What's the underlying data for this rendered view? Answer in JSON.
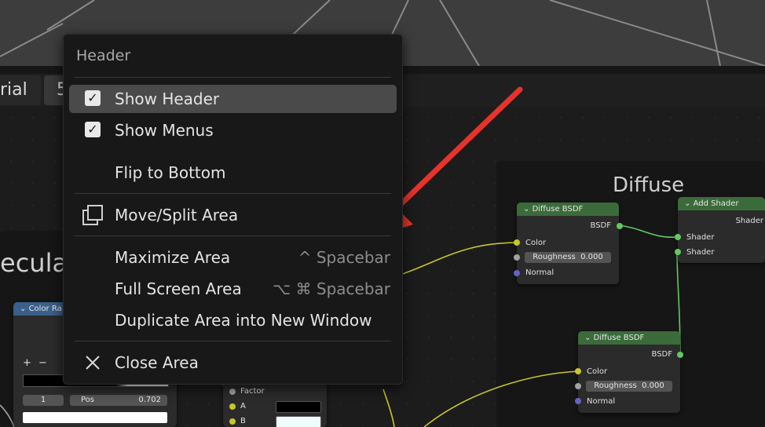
{
  "editor_header": {
    "material_text": "rial",
    "users_text": "5"
  },
  "frames": [
    {
      "label": "Diffuse"
    },
    {
      "label": "ecula"
    }
  ],
  "nodes": {
    "diffuse_bsdf_1": {
      "title": "Diffuse BSDF",
      "output": "BSDF",
      "color": "Color",
      "roughness_label": "Roughness",
      "roughness_value": "0.000",
      "normal": "Normal"
    },
    "diffuse_bsdf_2": {
      "title": "Diffuse BSDF",
      "output": "BSDF",
      "color": "Color",
      "roughness_label": "Roughness",
      "roughness_value": "0.000",
      "normal": "Normal"
    },
    "add_shader": {
      "title": "Add Shader",
      "output": "Shader",
      "in1": "Shader",
      "in2": "Shader"
    },
    "color_ramp": {
      "title": "Color Ra",
      "add": "+",
      "remove": "−",
      "index": "1",
      "pos_label": "Pos",
      "pos_value": "0.702"
    },
    "mix": {
      "factor": "Factor",
      "a": "A",
      "b": "B"
    }
  },
  "menu": {
    "title": "Header",
    "items": [
      {
        "label": "Show Header",
        "checked": true,
        "shortcut": "",
        "highlighted": true
      },
      {
        "label": "Show Menus",
        "checked": true,
        "shortcut": ""
      },
      {
        "label": "Flip to Bottom",
        "shortcut": ""
      },
      {
        "label": "Move/Split Area",
        "icon": "split-area-icon",
        "shortcut": ""
      },
      {
        "label": "Maximize Area",
        "shortcut": "^ Spacebar"
      },
      {
        "label": "Full Screen Area",
        "shortcut": "⌥ ⌘ Spacebar"
      },
      {
        "label": "Duplicate Area into New Window",
        "shortcut": ""
      },
      {
        "label": "Close Area",
        "icon": "close-icon",
        "shortcut": ""
      }
    ]
  },
  "colors": {
    "accent_arrow": "#e8322a",
    "node_header_green": "#3b6b3b",
    "node_header_blue": "#3a5f8a",
    "menu_bg": "#181818",
    "highlight": "#4a4a4a"
  }
}
